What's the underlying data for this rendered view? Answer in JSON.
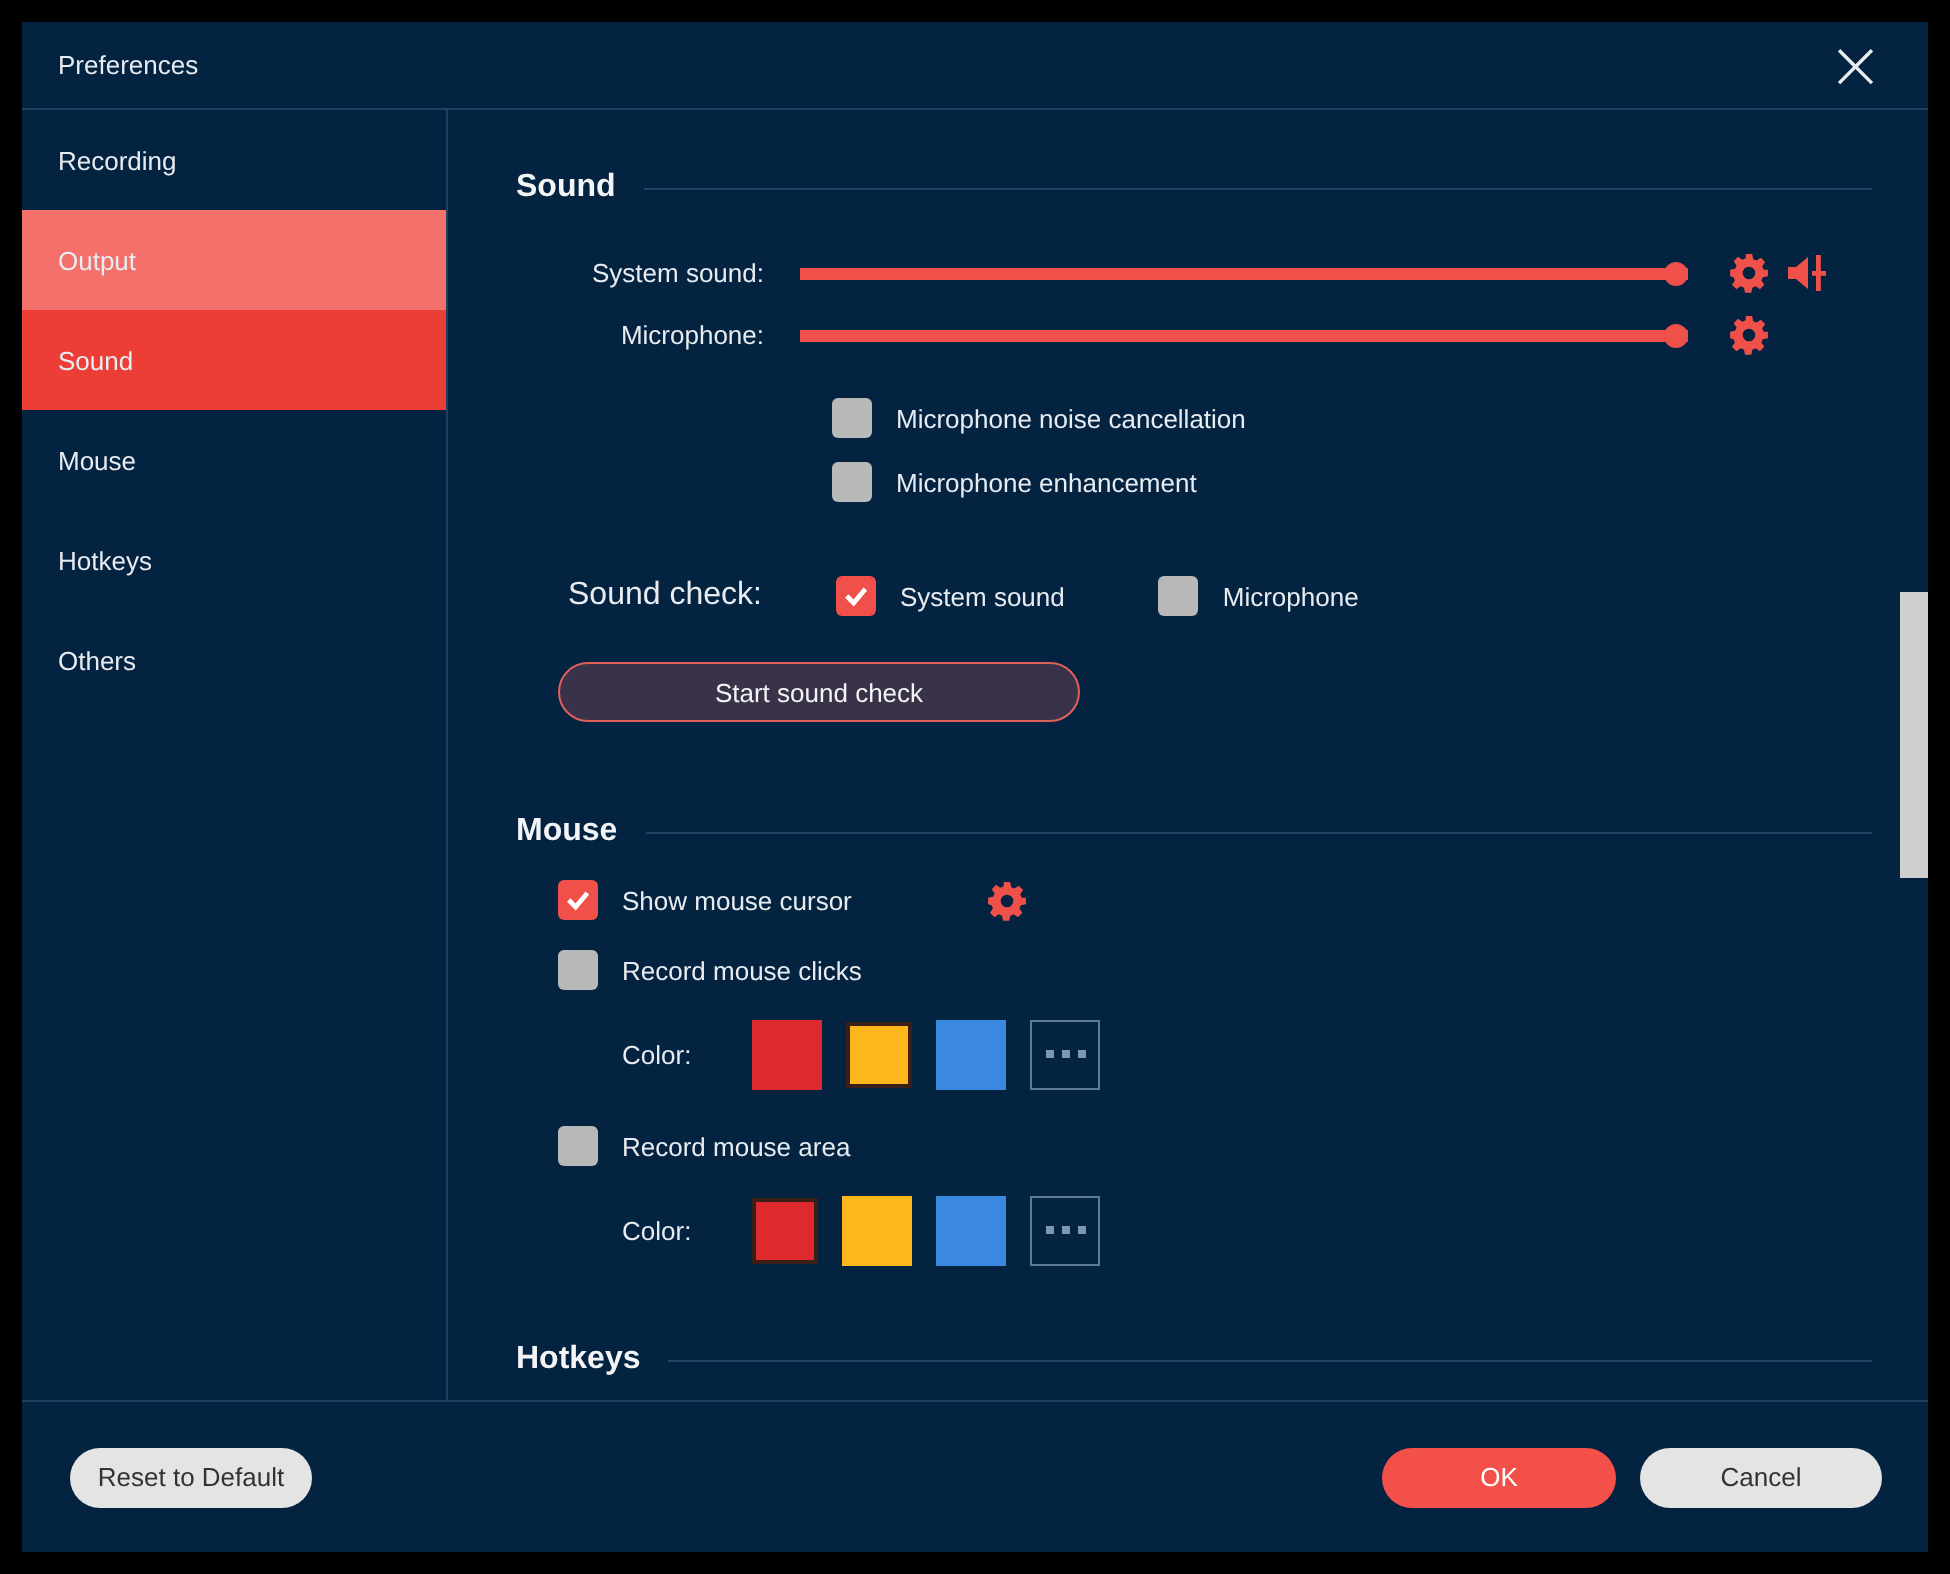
{
  "window": {
    "title": "Preferences",
    "close": "×"
  },
  "sidebar": {
    "items": [
      {
        "label": "Recording",
        "selected": false,
        "hovered": false
      },
      {
        "label": "Output",
        "selected": false,
        "hovered": true
      },
      {
        "label": "Sound",
        "selected": true,
        "hovered": false
      },
      {
        "label": "Mouse",
        "selected": false,
        "hovered": false
      },
      {
        "label": "Hotkeys",
        "selected": false,
        "hovered": false
      },
      {
        "label": "Others",
        "selected": false,
        "hovered": false
      }
    ]
  },
  "sound": {
    "heading": "Sound",
    "sliders": [
      {
        "label": "System sound:",
        "level": 1.0,
        "speaker": true
      },
      {
        "label": "Microphone:",
        "level": 1.0,
        "speaker": false
      }
    ],
    "options": [
      {
        "label": "Microphone noise cancellation",
        "checked": false
      },
      {
        "label": "Microphone enhancement",
        "checked": false
      }
    ],
    "sound_check": {
      "label": "Sound check:",
      "options": [
        {
          "label": "System sound",
          "checked": true
        },
        {
          "label": "Microphone",
          "checked": false
        }
      ]
    },
    "button": "Start sound check"
  },
  "mouse": {
    "heading": "Mouse",
    "show_cursor": {
      "label": "Show mouse cursor",
      "checked": true
    },
    "groups": [
      {
        "label": "Record mouse clicks",
        "checked": false,
        "color_label": "Color:",
        "swatches": [
          {
            "color": "#dc2a2f",
            "selected": false
          },
          {
            "color": "#fdb61b",
            "selected": true
          },
          {
            "color": "#3a88e0",
            "selected": false
          }
        ]
      },
      {
        "label": "Record mouse area",
        "checked": false,
        "color_label": "Color:",
        "swatches": [
          {
            "color": "#dc2a2f",
            "selected": true
          },
          {
            "color": "#fdb61b",
            "selected": false
          },
          {
            "color": "#3a88e0",
            "selected": false
          }
        ]
      }
    ]
  },
  "hotkeys": {
    "heading": "Hotkeys"
  },
  "footer": {
    "reset": "Reset to Default",
    "ok": "OK",
    "cancel": "Cancel"
  }
}
